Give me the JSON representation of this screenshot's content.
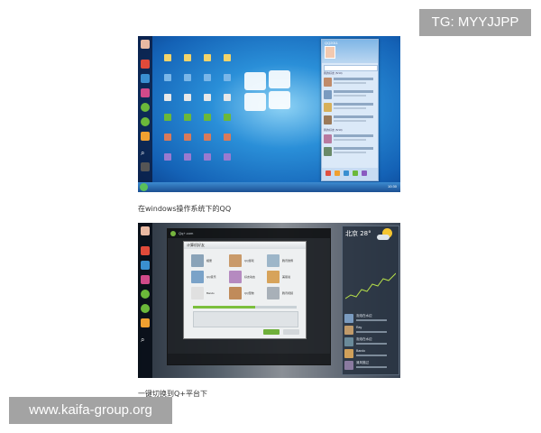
{
  "watermarks": {
    "top_right": "TG: MYYJJPP",
    "bottom_left": "www.kaifa-group.org"
  },
  "captions": {
    "first": "在windows操作系统下的QQ",
    "second": "一键切换到Q+平台下"
  },
  "shot1": {
    "desktop_icon_count": 24,
    "qq_panel": {
      "title": "QQ2011"
    },
    "qq_groups": [
      "我的好友 (5/10)",
      "我的好友 (5/10)"
    ],
    "taskbar": {
      "clock": "10:30"
    }
  },
  "shot2": {
    "window_title": "Qq+.com",
    "dialog_title": "计算机好友",
    "apps": [
      "相册",
      "QQ游戏",
      "腾讯微博",
      "QQ音乐",
      "好友动态",
      "美丽说",
      "Bando",
      "QQ宠物",
      "腾讯视频"
    ],
    "progress": 0.6,
    "weather": {
      "city_temp": "北京 28°"
    },
    "contacts": [
      "泡泡在水边",
      "Ray",
      "泡泡在水边",
      "Bando",
      "清风拂过"
    ]
  },
  "colors": {
    "qq_green": "#7bbf3d",
    "win_blue": "#1462b6",
    "watermark_grey": "#a3a3a3"
  }
}
